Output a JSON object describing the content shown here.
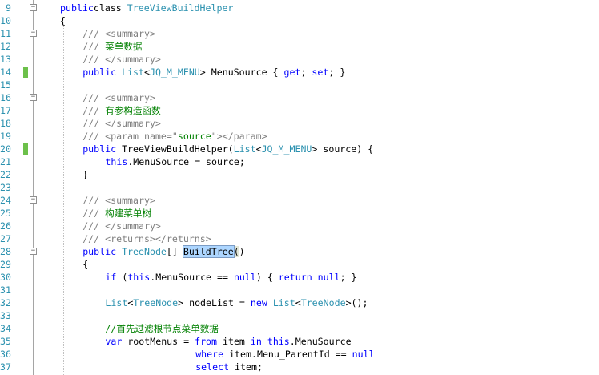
{
  "editor": {
    "lines": [
      {
        "ln": "9",
        "change": false,
        "fold": "minus",
        "indent": 0,
        "tokens": [
          [
            "kw",
            "public"
          ],
          [
            "",
            "class "
          ],
          [
            "ty",
            "TreeViewBuildHelper"
          ]
        ]
      },
      {
        "ln": "10",
        "change": false,
        "fold": "",
        "indent": 0,
        "tokens": [
          [
            "",
            "{"
          ]
        ]
      },
      {
        "ln": "11",
        "change": false,
        "fold": "minus",
        "indent": 1,
        "tokens": [
          [
            "dc",
            "/// <summary>"
          ]
        ]
      },
      {
        "ln": "12",
        "change": false,
        "fold": "",
        "indent": 1,
        "tokens": [
          [
            "dc",
            "/// "
          ],
          [
            "cm",
            "菜单数据"
          ]
        ]
      },
      {
        "ln": "13",
        "change": false,
        "fold": "",
        "indent": 1,
        "tokens": [
          [
            "dc",
            "/// </summary>"
          ]
        ]
      },
      {
        "ln": "14",
        "change": true,
        "fold": "",
        "indent": 1,
        "tokens": [
          [
            "kw",
            "public "
          ],
          [
            "ty",
            "List"
          ],
          [
            "",
            "<"
          ],
          [
            "ty",
            "JQ_M_MENU"
          ],
          [
            "",
            "> MenuSource { "
          ],
          [
            "kw",
            "get"
          ],
          [
            "",
            "; "
          ],
          [
            "kw",
            "set"
          ],
          [
            "",
            "; }"
          ]
        ]
      },
      {
        "ln": "15",
        "change": false,
        "fold": "",
        "indent": 0,
        "tokens": []
      },
      {
        "ln": "16",
        "change": false,
        "fold": "minus",
        "indent": 1,
        "tokens": [
          [
            "dc",
            "/// <summary>"
          ]
        ]
      },
      {
        "ln": "17",
        "change": false,
        "fold": "",
        "indent": 1,
        "tokens": [
          [
            "dc",
            "/// "
          ],
          [
            "cm",
            "有参构造函数"
          ]
        ]
      },
      {
        "ln": "18",
        "change": false,
        "fold": "",
        "indent": 1,
        "tokens": [
          [
            "dc",
            "/// </summary>"
          ]
        ]
      },
      {
        "ln": "19",
        "change": false,
        "fold": "",
        "indent": 1,
        "tokens": [
          [
            "dc",
            "/// <param name=\""
          ],
          [
            "cm",
            "source"
          ],
          [
            "dc",
            "\"></param>"
          ]
        ]
      },
      {
        "ln": "20",
        "change": true,
        "fold": "",
        "indent": 1,
        "tokens": [
          [
            "kw",
            "public "
          ],
          [
            "",
            "TreeViewBuildHelper("
          ],
          [
            "ty",
            "List"
          ],
          [
            "",
            "<"
          ],
          [
            "ty",
            "JQ_M_MENU"
          ],
          [
            "",
            "> source) {"
          ]
        ]
      },
      {
        "ln": "21",
        "change": false,
        "fold": "",
        "indent": 2,
        "tokens": [
          [
            "kw",
            "this"
          ],
          [
            "",
            ".MenuSource = source;"
          ]
        ]
      },
      {
        "ln": "22",
        "change": false,
        "fold": "",
        "indent": 1,
        "tokens": [
          [
            "",
            "}"
          ]
        ]
      },
      {
        "ln": "23",
        "change": false,
        "fold": "",
        "indent": 0,
        "tokens": []
      },
      {
        "ln": "24",
        "change": false,
        "fold": "minus",
        "indent": 1,
        "tokens": [
          [
            "dc",
            "/// <summary>"
          ]
        ]
      },
      {
        "ln": "25",
        "change": false,
        "fold": "",
        "indent": 1,
        "tokens": [
          [
            "dc",
            "/// "
          ],
          [
            "cm",
            "构建菜单树"
          ]
        ]
      },
      {
        "ln": "26",
        "change": false,
        "fold": "",
        "indent": 1,
        "tokens": [
          [
            "dc",
            "/// </summary>"
          ]
        ]
      },
      {
        "ln": "27",
        "change": false,
        "fold": "",
        "indent": 1,
        "tokens": [
          [
            "dc",
            "/// <returns></returns>"
          ]
        ]
      },
      {
        "ln": "28",
        "change": false,
        "fold": "minus",
        "indent": 1,
        "tokens": [
          [
            "kw",
            "public "
          ],
          [
            "ty",
            "TreeNode"
          ],
          [
            "",
            "[] "
          ],
          [
            "hl",
            "BuildTree"
          ],
          [
            "brm",
            "("
          ],
          [
            "",
            ")"
          ]
        ]
      },
      {
        "ln": "29",
        "change": false,
        "fold": "",
        "indent": 1,
        "tokens": [
          [
            "",
            "{"
          ]
        ]
      },
      {
        "ln": "30",
        "change": false,
        "fold": "",
        "indent": 2,
        "tokens": [
          [
            "kw",
            "if"
          ],
          [
            "",
            " ("
          ],
          [
            "kw",
            "this"
          ],
          [
            "",
            ".MenuSource == "
          ],
          [
            "kw",
            "null"
          ],
          [
            "",
            ") { "
          ],
          [
            "kw",
            "return null"
          ],
          [
            "",
            "; }"
          ]
        ]
      },
      {
        "ln": "31",
        "change": false,
        "fold": "",
        "indent": 0,
        "tokens": []
      },
      {
        "ln": "32",
        "change": false,
        "fold": "",
        "indent": 2,
        "tokens": [
          [
            "ty",
            "List"
          ],
          [
            "",
            "<"
          ],
          [
            "ty",
            "TreeNode"
          ],
          [
            "",
            "> nodeList = "
          ],
          [
            "kw",
            "new "
          ],
          [
            "ty",
            "List"
          ],
          [
            "",
            "<"
          ],
          [
            "ty",
            "TreeNode"
          ],
          [
            "",
            ">();"
          ]
        ]
      },
      {
        "ln": "33",
        "change": false,
        "fold": "",
        "indent": 0,
        "tokens": []
      },
      {
        "ln": "34",
        "change": false,
        "fold": "",
        "indent": 2,
        "tokens": [
          [
            "cm",
            "//首先过滤根节点菜单数据"
          ]
        ]
      },
      {
        "ln": "35",
        "change": false,
        "fold": "",
        "indent": 2,
        "tokens": [
          [
            "kw",
            "var"
          ],
          [
            "",
            " rootMenus = "
          ],
          [
            "kw",
            "from"
          ],
          [
            "",
            "",
            " item "
          ],
          [
            "kw",
            "in "
          ],
          [
            "kw",
            "this"
          ],
          [
            "",
            ".MenuSource"
          ]
        ]
      },
      {
        "ln": "36",
        "change": false,
        "fold": "",
        "indent": 6,
        "tokens": [
          [
            "kw",
            "where"
          ],
          [
            "",
            "",
            " item.Menu_ParentId == "
          ],
          [
            "kw",
            "null"
          ]
        ]
      },
      {
        "ln": "37",
        "change": false,
        "fold": "",
        "indent": 6,
        "tokens": [
          [
            "kw",
            "select"
          ],
          [
            "",
            "",
            " item;"
          ]
        ]
      }
    ]
  }
}
